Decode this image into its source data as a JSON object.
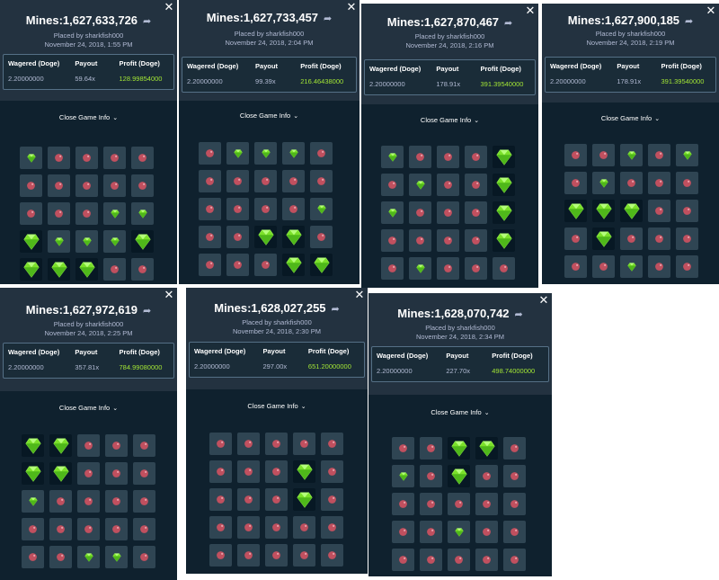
{
  "games": [
    {
      "title": "Mines:1,627,633,726",
      "placed_by": "Placed by sharkfish000",
      "date": "November 24, 2018, 1:55 PM",
      "wagered_label": "Wagered (Doge)",
      "payout_label": "Payout",
      "profit_label": "Profit (Doge)",
      "wagered": "2.20000000",
      "payout": "59.64x",
      "profit": "128.99854000",
      "close_info": "Close Game Info",
      "grid": [
        "gmmmm",
        "mmmmm",
        "mmmgg",
        "GgggG",
        "GGGmm"
      ]
    },
    {
      "title": "Mines:1,627,733,457",
      "placed_by": "Placed by sharkfish000",
      "date": "November 24, 2018, 2:04 PM",
      "wagered_label": "Wagered (Doge)",
      "payout_label": "Payout",
      "profit_label": "Profit (Doge)",
      "wagered": "2.20000000",
      "payout": "99.39x",
      "profit": "216.46438000",
      "close_info": "Close Game Info",
      "grid": [
        "mgggm",
        "mmmmm",
        "mmmmg",
        "mmGGm",
        "mmmGG"
      ]
    },
    {
      "title": "Mines:1,627,870,467",
      "placed_by": "Placed by sharkfish000",
      "date": "November 24, 2018, 2:16 PM",
      "wagered_label": "Wagered (Doge)",
      "payout_label": "Payout",
      "profit_label": "Profit (Doge)",
      "wagered": "2.20000000",
      "payout": "178.91x",
      "profit": "391.39540000",
      "close_info": "Close Game Info",
      "grid": [
        "gmmmG",
        "mgmmG",
        "gmmmG",
        "mmmmG",
        "mgmmm"
      ]
    },
    {
      "title": "Mines:1,627,900,185",
      "placed_by": "Placed by sharkfish000",
      "date": "November 24, 2018, 2:19 PM",
      "wagered_label": "Wagered (Doge)",
      "payout_label": "Payout",
      "profit_label": "Profit (Doge)",
      "wagered": "2.20000000",
      "payout": "178.91x",
      "profit": "391.39540000",
      "close_info": "Close Game Info",
      "grid": [
        "mmgmg",
        "mgmmm",
        "GGGmm",
        "mGmmm",
        "mmgmm"
      ]
    },
    {
      "title": "Mines:1,627,972,619",
      "placed_by": "Placed by sharkfish000",
      "date": "November 24, 2018, 2:25 PM",
      "wagered_label": "Wagered (Doge)",
      "payout_label": "Payout",
      "profit_label": "Profit (Doge)",
      "wagered": "2.20000000",
      "payout": "357.81x",
      "profit": "784.99080000",
      "close_info": "Close Game Info",
      "grid": [
        "GGmmm",
        "GGmmm",
        "gmmmm",
        "mmmmm",
        "mmggm"
      ]
    },
    {
      "title": "Mines:1,628,027,255",
      "placed_by": "Placed by sharkfish000",
      "date": "November 24, 2018, 2:30 PM",
      "wagered_label": "Wagered (Doge)",
      "payout_label": "Payout",
      "profit_label": "Profit (Doge)",
      "wagered": "2.20000000",
      "payout": "297.00x",
      "profit": "651.20000000",
      "close_info": "Close Game Info",
      "grid": [
        "mmmmm",
        "mmmGm",
        "mmmGm",
        "mmmmm",
        "mmmmm"
      ]
    },
    {
      "title": "Mines:1,628,070,742",
      "placed_by": "Placed by sharkfish000",
      "date": "November 24, 2018, 2:34 PM",
      "wagered_label": "Wagered (Doge)",
      "payout_label": "Payout",
      "profit_label": "Profit (Doge)",
      "wagered": "2.20000000",
      "payout": "227.70x",
      "profit": "498.74000000",
      "close_info": "Close Game Info",
      "grid": [
        "mmGGm",
        "gmGmm",
        "mmmmm",
        "mmgmm",
        "mmmmm"
      ]
    }
  ],
  "colors": {
    "panel_header": "#233240",
    "panel_body": "#0f212e",
    "tile": "#2f4553",
    "revealed_tile": "#071824",
    "gem": "#7be02a",
    "mine": "#c0505f",
    "profit_green": "#a3e635"
  },
  "icons": {
    "share": "share-arrow-icon",
    "close": "close-icon",
    "chevron": "chevron-down-icon",
    "gem": "gem-icon",
    "mine": "mine-icon"
  }
}
